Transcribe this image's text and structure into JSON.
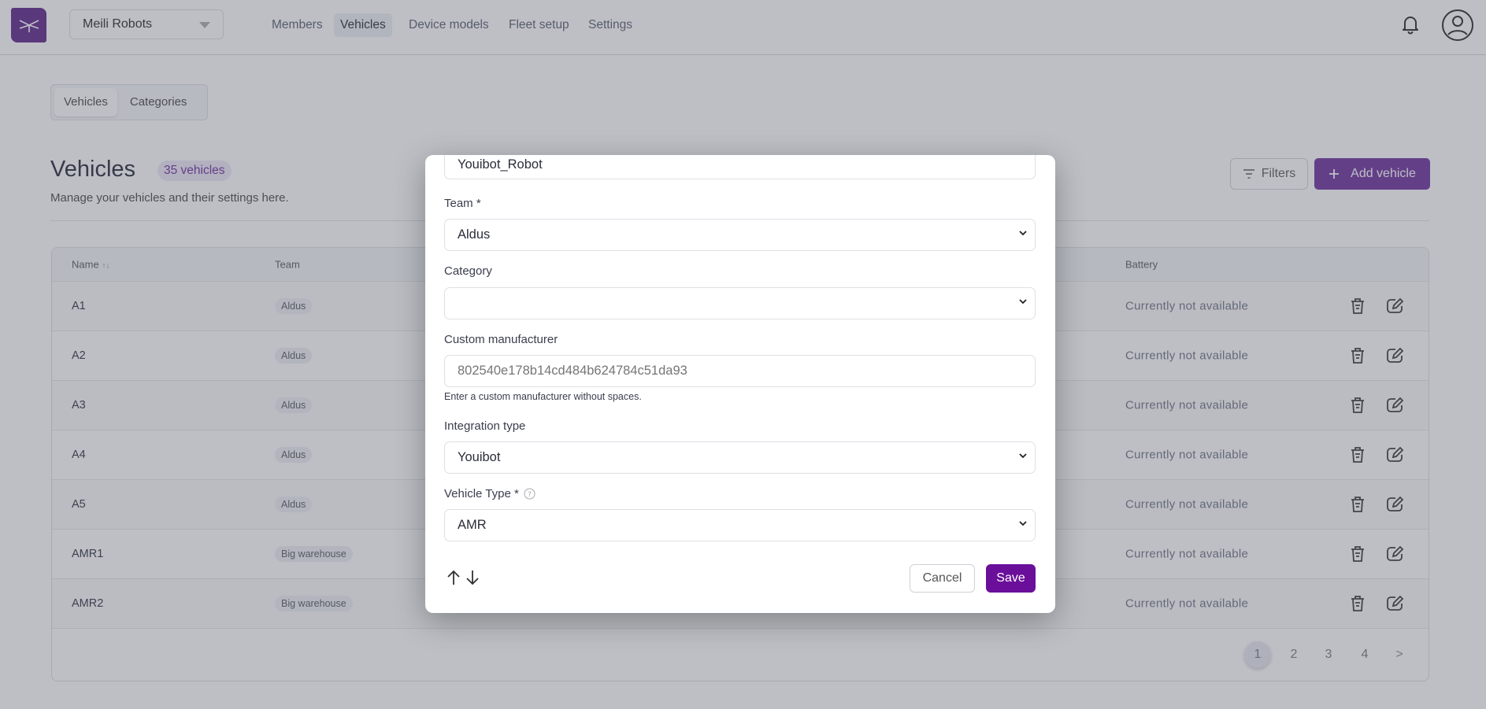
{
  "nav": {
    "org": "Meili Robots",
    "items": [
      {
        "label": "Members",
        "active": false
      },
      {
        "label": "Vehicles",
        "active": true
      },
      {
        "label": "Device models",
        "active": false
      },
      {
        "label": "Fleet setup",
        "active": false
      },
      {
        "label": "Settings",
        "active": false
      }
    ]
  },
  "tabs": [
    "Vehicles",
    "Categories"
  ],
  "page": {
    "title": "Vehicles",
    "count_badge": "35 vehicles",
    "subtitle": "Manage your vehicles and their settings here.",
    "filters_label": "Filters",
    "add_label": "Add vehicle",
    "accent": "#6a2a9a"
  },
  "table": {
    "headers": {
      "name": "Name",
      "sort": "↑↓",
      "team": "Team",
      "battery": "Battery"
    },
    "rows": [
      {
        "name": "A1",
        "team": "Aldus",
        "battery": "Currently not available"
      },
      {
        "name": "A2",
        "team": "Aldus",
        "battery": "Currently not available"
      },
      {
        "name": "A3",
        "team": "Aldus",
        "battery": "Currently not available"
      },
      {
        "name": "A4",
        "team": "Aldus",
        "battery": "Currently not available"
      },
      {
        "name": "A5",
        "team": "Aldus",
        "battery": "Currently not available"
      },
      {
        "name": "AMR1",
        "team": "Big warehouse",
        "battery": "Currently not available"
      },
      {
        "name": "AMR2",
        "team": "Big warehouse",
        "battery": "Currently not available"
      }
    ],
    "pages": [
      "1",
      "2",
      "3",
      "4"
    ],
    "current_page": "1",
    "next": ">"
  },
  "modal": {
    "name_value": "Youibot_Robot",
    "team_label": "Team *",
    "team_value": "Aldus",
    "category_label": "Category",
    "category_value": "",
    "manufacturer_label": "Custom manufacturer",
    "manufacturer_placeholder": "802540e178b14cd484b624784c51da93",
    "manufacturer_help": "Enter a custom manufacturer without spaces.",
    "integration_label": "Integration type",
    "integration_value": "Youibot",
    "vehicle_type_label": "Vehicle Type *",
    "vehicle_type_value": "AMR",
    "cancel_label": "Cancel",
    "save_label": "Save",
    "save_color": "#6a0f9a"
  }
}
